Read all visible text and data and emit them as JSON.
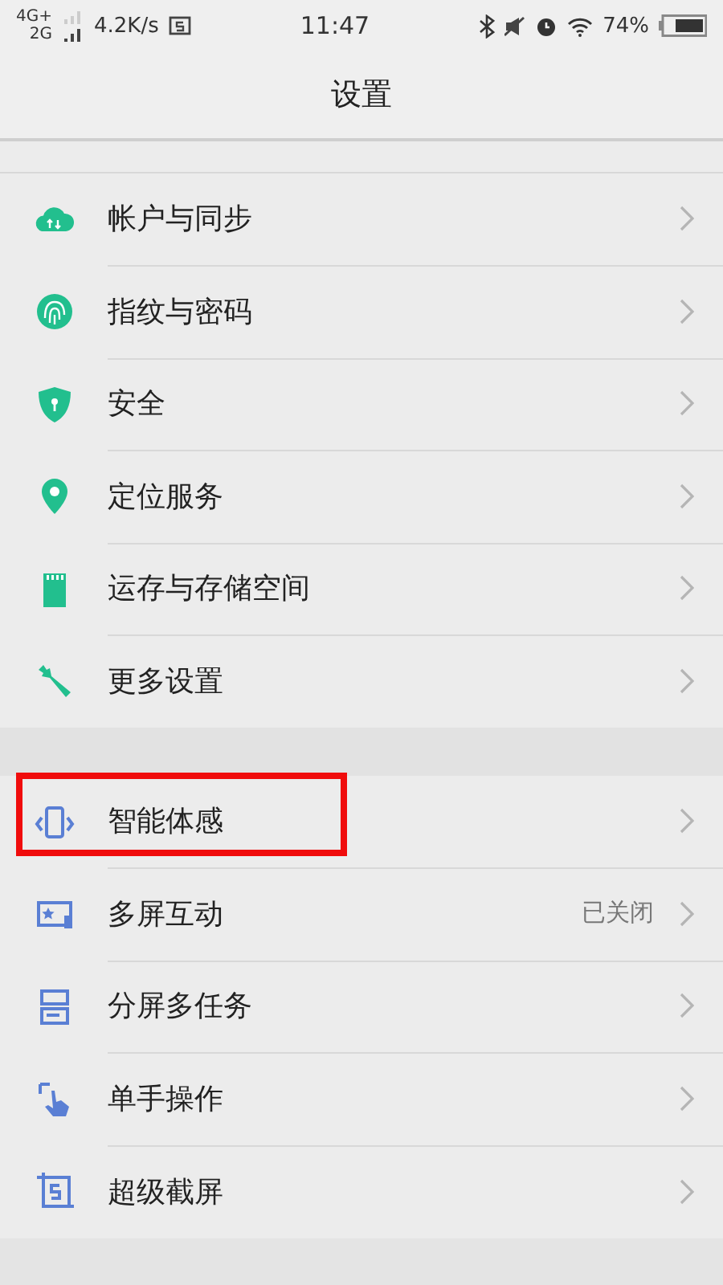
{
  "status_bar": {
    "network_top": "4G+",
    "network_bottom": "2G",
    "speed": "4.2K/s",
    "time": "11:47",
    "battery": "74%"
  },
  "header": {
    "title": "设置"
  },
  "groups": [
    {
      "items": [
        {
          "label": "帐户与同步",
          "highlighted": false
        },
        {
          "label": "指纹与密码",
          "highlighted": false
        },
        {
          "label": "安全",
          "highlighted": false
        },
        {
          "label": "定位服务",
          "highlighted": false
        },
        {
          "label": "运存与存储空间",
          "highlighted": false
        },
        {
          "label": "更多设置",
          "highlighted": false
        }
      ]
    },
    {
      "items": [
        {
          "label": "智能体感",
          "highlighted": true
        },
        {
          "label": "多屏互动",
          "value": "已关闭",
          "highlighted": false
        },
        {
          "label": "分屏多任务",
          "highlighted": false
        },
        {
          "label": "单手操作",
          "highlighted": false
        },
        {
          "label": "超级截屏",
          "highlighted": false
        }
      ]
    }
  ]
}
